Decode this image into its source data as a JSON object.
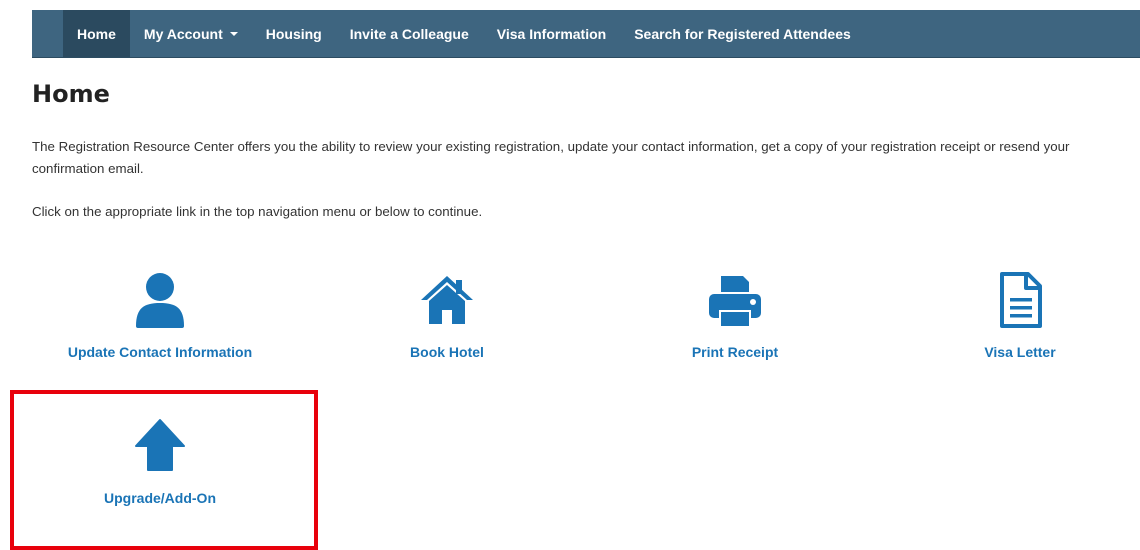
{
  "nav": {
    "items": [
      {
        "label": "Home",
        "active": true
      },
      {
        "label": "My Account",
        "dropdown": true
      },
      {
        "label": "Housing"
      },
      {
        "label": "Invite a Colleague"
      },
      {
        "label": "Visa Information"
      },
      {
        "label": "Search for Registered Attendees"
      }
    ]
  },
  "page": {
    "title": "Home",
    "intro": "The Registration Resource Center offers you the ability to review your existing registration, update your contact information, get a copy of your registration receipt or resend your confirmation email.",
    "instruction": "Click on the appropriate link in the top navigation menu or below to continue."
  },
  "tiles": [
    {
      "label": "Update Contact Information",
      "icon": "user-icon"
    },
    {
      "label": "Book Hotel",
      "icon": "home-icon"
    },
    {
      "label": "Print Receipt",
      "icon": "printer-icon"
    },
    {
      "label": "Visa Letter",
      "icon": "document-icon"
    },
    {
      "label": "Upgrade/Add-On",
      "icon": "arrow-up-icon"
    }
  ],
  "colors": {
    "nav_bg": "#3e6580",
    "nav_active": "#2b4a5f",
    "accent": "#1a74b6",
    "highlight": "#e8000b"
  }
}
